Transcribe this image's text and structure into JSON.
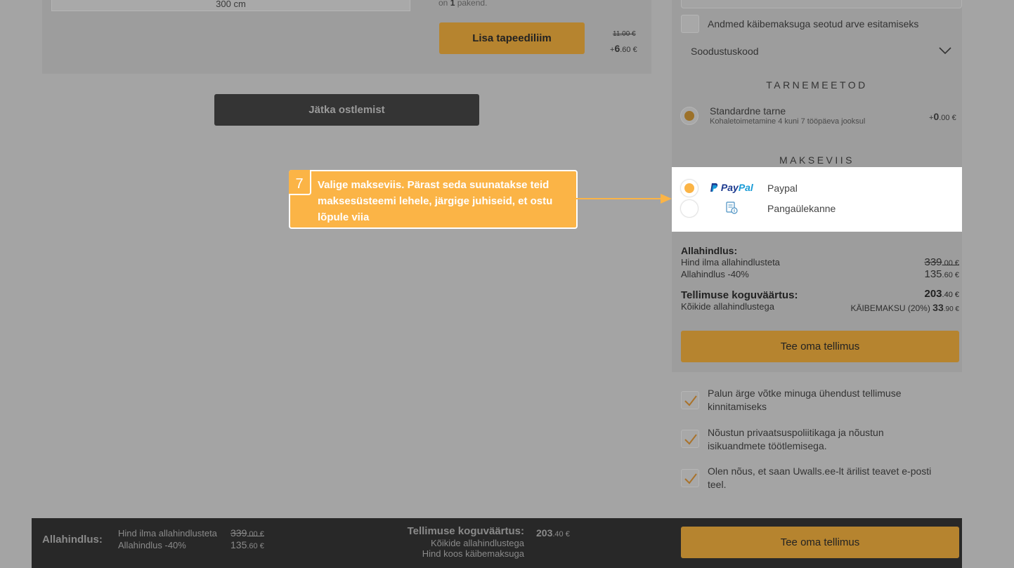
{
  "product": {
    "size_value": "300  cm",
    "pack_prefix": "on ",
    "pack_count": "1",
    "pack_suffix": " pakend.",
    "add_button": "Lisa tapeediliim",
    "price_old": "11.00 €",
    "price_new_sign": "+",
    "price_new_main": "6",
    "price_new_dec": ".60 €"
  },
  "continue_button": "Jätka ostlemist",
  "checkout": {
    "invoice_label": "Andmed käibemaksuga seotud arve esitamiseks",
    "coupon_label": "Soodustuskood",
    "shipping_heading": "TARNEMEETOD",
    "shipping": {
      "name": "Standardne tarne",
      "desc": "Kohaletoimetamine 4 kuni 7 tööpäeva jooksul",
      "price_sign": "+",
      "price_main": "0",
      "price_dec": ".00 €"
    },
    "payment_heading": "MAKSEVIIS",
    "payment_options": [
      {
        "label": "Paypal",
        "logo_p1": "Pay",
        "logo_p2": "Pal",
        "selected": true
      },
      {
        "label": "Pangaülekanne",
        "selected": false
      }
    ],
    "summary": {
      "discount_title": "Allahindlus:",
      "price_without_label": "Hind ilma allahindlusteta",
      "price_without_main": "339",
      "price_without_dec": ".00 €",
      "discount_label": "Allahindlus -40%",
      "discount_main": "135",
      "discount_dec": ".60 €",
      "total_title": "Tellimuse koguväärtus:",
      "total_sub": "Kõikide allahindlustega",
      "total_main": "203",
      "total_dec": ".40 €",
      "vat_label": "KÄIBEMAKSU (20%) ",
      "vat_main": "33",
      "vat_dec": ".90 €"
    },
    "order_button": "Tee oma tellimus",
    "consents": [
      "Palun ärge võtke minuga ühendust tellimuse kinnitamiseks",
      "Nõustun privaatsuspoliitikaga ja nõustun isikuandmete töötlemisega.",
      "Olen nõus, et saan Uwalls.ee-lt ärilist teavet e-posti teel."
    ]
  },
  "bottom_bar": {
    "discount_title": "Allahindlus:",
    "price_without_label": "Hind ilma allahindlusteta",
    "price_without_main": "339",
    "price_without_dec": ".00 €",
    "discount_label": "Allahindlus -40%",
    "discount_main": "135",
    "discount_dec": ".60 €",
    "total_title": "Tellimuse koguväärtus:",
    "total_sub1": "Kõikide allahindlustega",
    "total_sub2": "Hind koos käibemaksuga",
    "total_main": "203",
    "total_dec": ".40 €",
    "order_button": "Tee oma tellimus"
  },
  "tooltip": {
    "step": "7",
    "text": "Valige makseviis. Pärast seda suunatakse teid maksesüsteemi lehele, järgige juhiseid, et ostu lõpule viia"
  },
  "colors": {
    "accent": "#fbb446",
    "button_dimmed": "#b6842f",
    "overlay_bg": "#a4a4a4",
    "bottom_bar": "#282828"
  }
}
